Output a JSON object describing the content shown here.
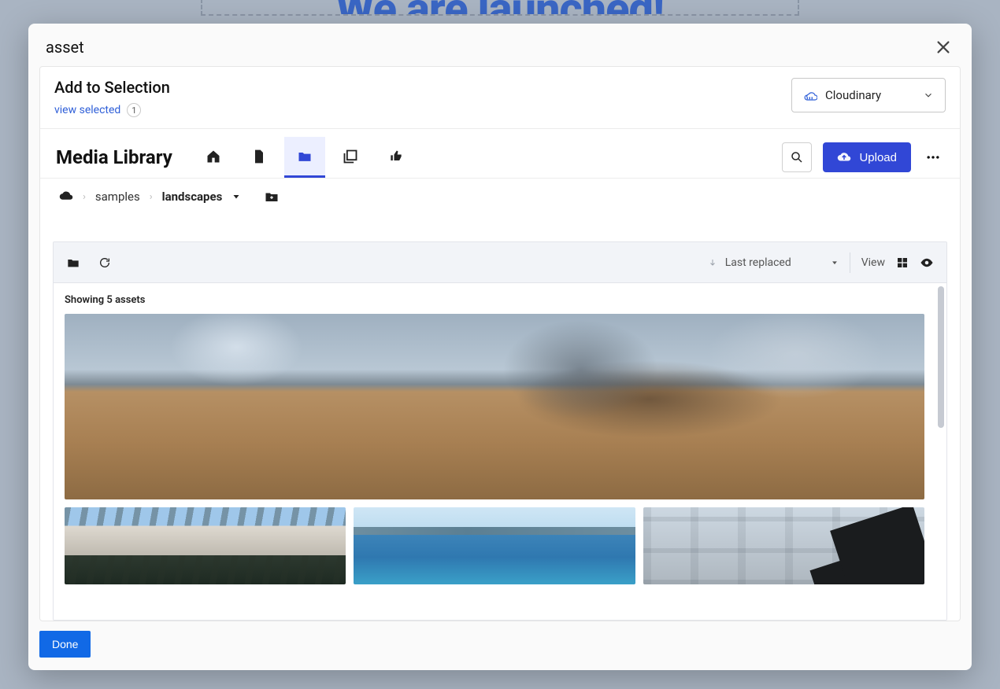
{
  "background_banner_text": "We are launched!",
  "modal_title": "asset",
  "panel": {
    "title": "Add to Selection",
    "view_selected_label": "view selected",
    "selected_count": "1",
    "provider": {
      "label": "Cloudinary"
    }
  },
  "media_library": {
    "title": "Media Library",
    "tabs": {
      "home": "home",
      "file": "file",
      "folder": "folder",
      "collections": "collections",
      "moderation": "moderation",
      "active": "folder"
    },
    "upload_label": "Upload",
    "breadcrumb": {
      "root_icon": "cloud",
      "items": [
        "samples",
        "landscapes"
      ]
    },
    "toolbar": {
      "sort_label": "Last replaced",
      "view_label": "View"
    },
    "assets_count_text": "Showing 5 assets"
  },
  "footer": {
    "done_label": "Done"
  }
}
